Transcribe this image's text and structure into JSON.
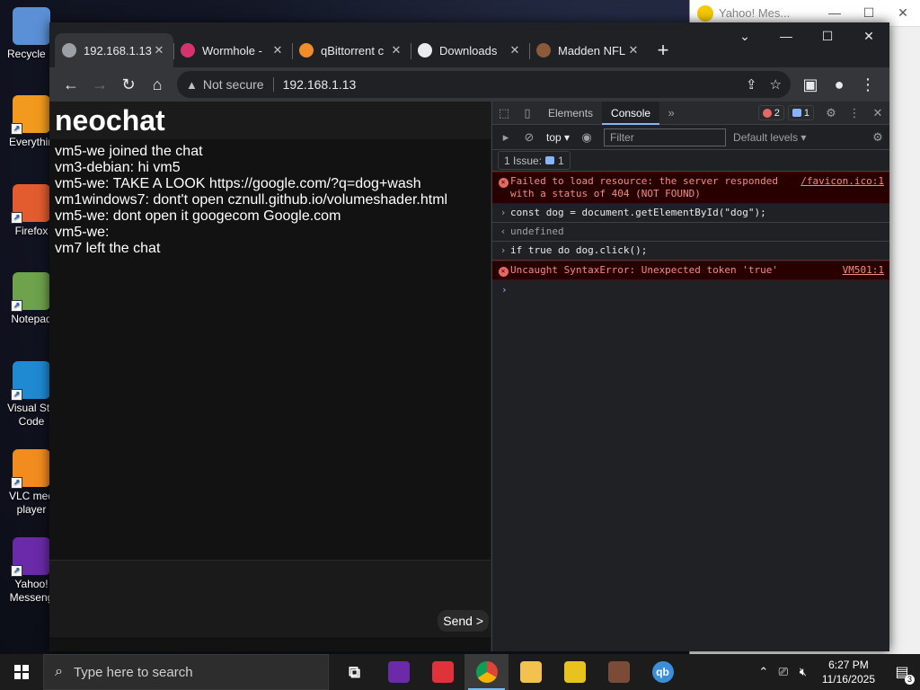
{
  "desktop": {
    "icons": [
      {
        "label": "Recycle B",
        "icon": "recycle-bin-icon",
        "color": "#5b8fd6"
      },
      {
        "label": "Everythin",
        "icon": "everything-search-icon",
        "color": "#f29a1d"
      },
      {
        "label": "Firefox",
        "icon": "firefox-icon",
        "color": "#e25c2f"
      },
      {
        "label": "Notepad",
        "icon": "notepad-icon",
        "color": "#6ea24b"
      },
      {
        "label": "Visual Stu\nCode",
        "icon": "vscode-icon",
        "color": "#1f8ad2"
      },
      {
        "label": "VLC med\nplayer",
        "icon": "vlc-icon",
        "color": "#f28c1e"
      },
      {
        "label": "Yahoo!\nMesseng",
        "icon": "yahoo-messenger-icon",
        "color": "#6b2aa8"
      }
    ]
  },
  "yahoo_window": {
    "title": "Yahoo! Mes..."
  },
  "browser": {
    "tabs": [
      {
        "title": "192.168.1.13",
        "active": true,
        "icon": "globe-icon",
        "color": "#9aa0a6"
      },
      {
        "title": "Wormhole -",
        "active": false,
        "icon": "wormhole-icon",
        "color": "#d6336c"
      },
      {
        "title": "qBittorrent c",
        "active": false,
        "icon": "qbittorrent-icon",
        "color": "#f08c2a"
      },
      {
        "title": "Downloads",
        "active": false,
        "icon": "download-icon",
        "color": "#e8eaed"
      },
      {
        "title": "Madden NFL",
        "active": false,
        "icon": "madden-icon",
        "color": "#8a5a3a"
      }
    ],
    "omnibox": {
      "security_label": "Not secure",
      "url": "192.168.1.13"
    }
  },
  "neochat": {
    "title": "neochat",
    "messages": [
      "vm5-we joined the chat",
      "vm3-debian: hi vm5",
      "vm5-we: TAKE A LOOK https://google.com/?q=dog+wash",
      "vm1windows7: dont't open cznull.github.io/volumeshader.html",
      "vm5-we: dont open it googecom Google.com",
      "vm5-we:",
      "vm7 left the chat"
    ],
    "send_label": "Send >"
  },
  "devtools": {
    "tabs": [
      "Elements",
      "Console"
    ],
    "active_tab": "Console",
    "error_count": "2",
    "message_count": "1",
    "context": "top",
    "filter_placeholder": "Filter",
    "levels": "Default levels",
    "issues_label": "1 Issue:",
    "issues_count": "1",
    "console": [
      {
        "type": "error",
        "text": "Failed to load resource: the server responded with a status of 404 (NOT FOUND)",
        "source": "/favicon.ico:1"
      },
      {
        "type": "input",
        "text": "const dog = document.getElementById(\"dog\");"
      },
      {
        "type": "return",
        "text": "undefined"
      },
      {
        "type": "input",
        "text": "if true do dog.click();"
      },
      {
        "type": "error",
        "text": "Uncaught SyntaxError: Unexpected token 'true'",
        "source": "VM501:1"
      }
    ]
  },
  "taskbar": {
    "search_placeholder": "Type here to search",
    "apps": [
      {
        "icon": "task-view-icon",
        "color": "#1c1c1c",
        "active": false
      },
      {
        "icon": "yahoo-messenger-icon",
        "color": "#6b2aa8",
        "active": false
      },
      {
        "icon": "anydesk-icon",
        "color": "#e0323a",
        "active": false
      },
      {
        "icon": "chrome-icon",
        "color": "#4a90e2",
        "active": true
      },
      {
        "icon": "file-explorer-icon",
        "color": "#f2c14e",
        "active": false
      },
      {
        "icon": "dvd-icon",
        "color": "#e8c31e",
        "active": false
      },
      {
        "icon": "game-icon",
        "color": "#7a4b36",
        "active": false
      },
      {
        "icon": "qbittorrent-icon",
        "color": "#3b8fd8",
        "active": false
      }
    ],
    "time": "6:27 PM",
    "date": "11/16/2025",
    "notification_count": "3"
  }
}
